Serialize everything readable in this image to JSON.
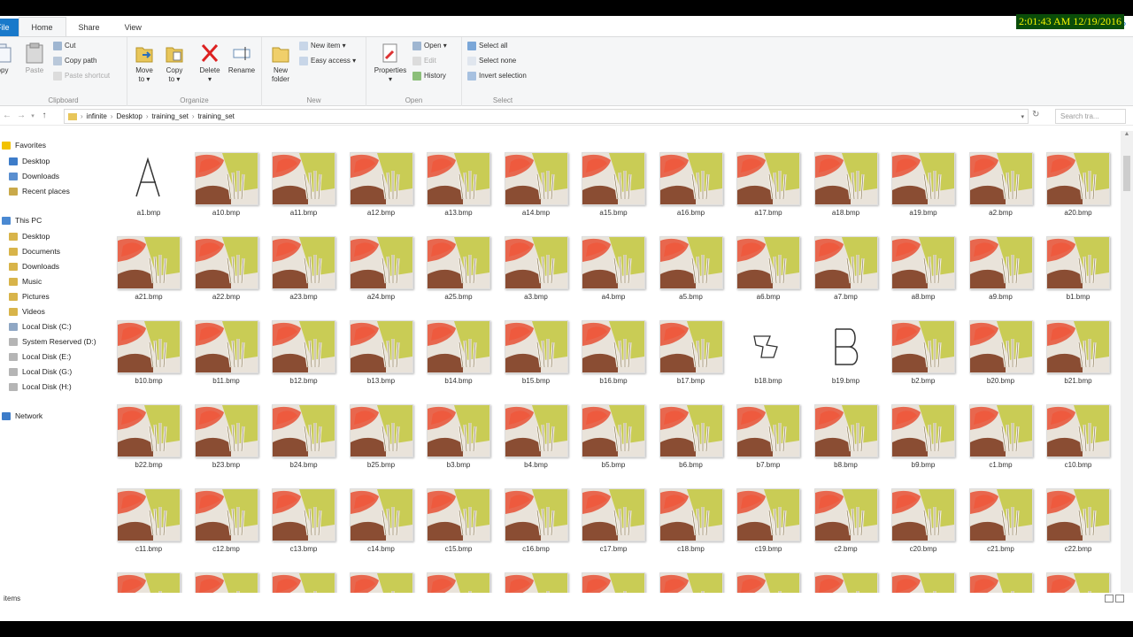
{
  "clock": "2:01:43 AM 12/19/2016",
  "tabs": {
    "file": "File",
    "home": "Home",
    "share": "Share",
    "view": "View"
  },
  "ribbon": {
    "clipboard": {
      "copy": "opy",
      "paste": "Paste",
      "cut": "Cut",
      "copy_path": "Copy path",
      "paste_shortcut": "Paste shortcut",
      "label": "Clipboard"
    },
    "organize": {
      "move_to": "Move",
      "move_to2": "to ▾",
      "copy_to": "Copy",
      "copy_to2": "to ▾",
      "delete": "Delete",
      "delete2": "▾",
      "rename": "Rename",
      "label": "Organize"
    },
    "new": {
      "new_folder": "New",
      "new_folder2": "folder",
      "new_item": "New item ▾",
      "easy_access": "Easy access ▾",
      "label": "New"
    },
    "open": {
      "properties": "Properties",
      "properties2": "▾",
      "open": "Open ▾",
      "edit": "Edit",
      "history": "History",
      "label": "Open"
    },
    "select": {
      "select_all": "Select all",
      "select_none": "Select none",
      "invert": "Invert selection",
      "label": "Select"
    }
  },
  "address": {
    "crumbs": [
      "infinite",
      "Desktop",
      "training_set",
      "training_set"
    ],
    "search_placeholder": "Search tra..."
  },
  "nav": {
    "favorites": "Favorites",
    "desktop": "Desktop",
    "downloads": "Downloads",
    "recent": "Recent places",
    "this_pc": "This PC",
    "pc_desktop": "Desktop",
    "documents": "Documents",
    "pc_downloads": "Downloads",
    "music": "Music",
    "pictures": "Pictures",
    "videos": "Videos",
    "disk_c": "Local Disk (C:)",
    "sys_reserved": "System Reserved (D:)",
    "disk_e": "Local Disk (E:)",
    "disk_g": "Local Disk (G:)",
    "disk_h": "Local Disk (H:)",
    "network": "Network"
  },
  "files": [
    {
      "name": "a1.bmp",
      "thumb": "letter-a"
    },
    {
      "name": "a10.bmp",
      "thumb": "photo"
    },
    {
      "name": "a11.bmp",
      "thumb": "photo"
    },
    {
      "name": "a12.bmp",
      "thumb": "photo"
    },
    {
      "name": "a13.bmp",
      "thumb": "photo"
    },
    {
      "name": "a14.bmp",
      "thumb": "photo"
    },
    {
      "name": "a15.bmp",
      "thumb": "photo"
    },
    {
      "name": "a16.bmp",
      "thumb": "photo"
    },
    {
      "name": "a17.bmp",
      "thumb": "photo"
    },
    {
      "name": "a18.bmp",
      "thumb": "photo"
    },
    {
      "name": "a19.bmp",
      "thumb": "photo"
    },
    {
      "name": "a2.bmp",
      "thumb": "photo"
    },
    {
      "name": "a20.bmp",
      "thumb": "photo"
    },
    {
      "name": "a21.bmp",
      "thumb": "photo"
    },
    {
      "name": "a22.bmp",
      "thumb": "photo"
    },
    {
      "name": "a23.bmp",
      "thumb": "photo"
    },
    {
      "name": "a24.bmp",
      "thumb": "photo"
    },
    {
      "name": "a25.bmp",
      "thumb": "photo"
    },
    {
      "name": "a3.bmp",
      "thumb": "photo"
    },
    {
      "name": "a4.bmp",
      "thumb": "photo"
    },
    {
      "name": "a5.bmp",
      "thumb": "photo"
    },
    {
      "name": "a6.bmp",
      "thumb": "photo"
    },
    {
      "name": "a7.bmp",
      "thumb": "photo"
    },
    {
      "name": "a8.bmp",
      "thumb": "photo"
    },
    {
      "name": "a9.bmp",
      "thumb": "photo"
    },
    {
      "name": "b1.bmp",
      "thumb": "photo"
    },
    {
      "name": "b10.bmp",
      "thumb": "photo"
    },
    {
      "name": "b11.bmp",
      "thumb": "photo"
    },
    {
      "name": "b12.bmp",
      "thumb": "photo"
    },
    {
      "name": "b13.bmp",
      "thumb": "photo"
    },
    {
      "name": "b14.bmp",
      "thumb": "photo"
    },
    {
      "name": "b15.bmp",
      "thumb": "photo"
    },
    {
      "name": "b16.bmp",
      "thumb": "photo"
    },
    {
      "name": "b17.bmp",
      "thumb": "photo"
    },
    {
      "name": "b18.bmp",
      "thumb": "letter-b-small"
    },
    {
      "name": "b19.bmp",
      "thumb": "letter-b"
    },
    {
      "name": "b2.bmp",
      "thumb": "photo"
    },
    {
      "name": "b20.bmp",
      "thumb": "photo"
    },
    {
      "name": "b21.bmp",
      "thumb": "photo"
    },
    {
      "name": "b22.bmp",
      "thumb": "photo"
    },
    {
      "name": "b23.bmp",
      "thumb": "photo"
    },
    {
      "name": "b24.bmp",
      "thumb": "photo"
    },
    {
      "name": "b25.bmp",
      "thumb": "photo"
    },
    {
      "name": "b3.bmp",
      "thumb": "photo"
    },
    {
      "name": "b4.bmp",
      "thumb": "photo"
    },
    {
      "name": "b5.bmp",
      "thumb": "photo"
    },
    {
      "name": "b6.bmp",
      "thumb": "photo"
    },
    {
      "name": "b7.bmp",
      "thumb": "photo"
    },
    {
      "name": "b8.bmp",
      "thumb": "photo"
    },
    {
      "name": "b9.bmp",
      "thumb": "photo"
    },
    {
      "name": "c1.bmp",
      "thumb": "photo"
    },
    {
      "name": "c10.bmp",
      "thumb": "photo"
    },
    {
      "name": "c11.bmp",
      "thumb": "photo"
    },
    {
      "name": "c12.bmp",
      "thumb": "photo"
    },
    {
      "name": "c13.bmp",
      "thumb": "photo"
    },
    {
      "name": "c14.bmp",
      "thumb": "photo"
    },
    {
      "name": "c15.bmp",
      "thumb": "photo"
    },
    {
      "name": "c16.bmp",
      "thumb": "photo"
    },
    {
      "name": "c17.bmp",
      "thumb": "photo"
    },
    {
      "name": "c18.bmp",
      "thumb": "photo"
    },
    {
      "name": "c19.bmp",
      "thumb": "photo"
    },
    {
      "name": "c2.bmp",
      "thumb": "photo"
    },
    {
      "name": "c20.bmp",
      "thumb": "photo"
    },
    {
      "name": "c21.bmp",
      "thumb": "photo"
    },
    {
      "name": "c22.bmp",
      "thumb": "photo"
    },
    {
      "name": "",
      "thumb": "photo"
    },
    {
      "name": "",
      "thumb": "photo"
    },
    {
      "name": "",
      "thumb": "photo"
    },
    {
      "name": "",
      "thumb": "photo"
    },
    {
      "name": "",
      "thumb": "photo"
    },
    {
      "name": "",
      "thumb": "photo"
    },
    {
      "name": "",
      "thumb": "photo"
    },
    {
      "name": "",
      "thumb": "photo"
    },
    {
      "name": "",
      "thumb": "photo"
    },
    {
      "name": "",
      "thumb": "photo"
    },
    {
      "name": "",
      "thumb": "photo"
    },
    {
      "name": "",
      "thumb": "photo"
    },
    {
      "name": "",
      "thumb": "photo"
    }
  ],
  "status": "items",
  "colors": {
    "accent": "#1979ca",
    "clock_bg": "#0a4d0a",
    "clock_fg": "#f4f400"
  }
}
